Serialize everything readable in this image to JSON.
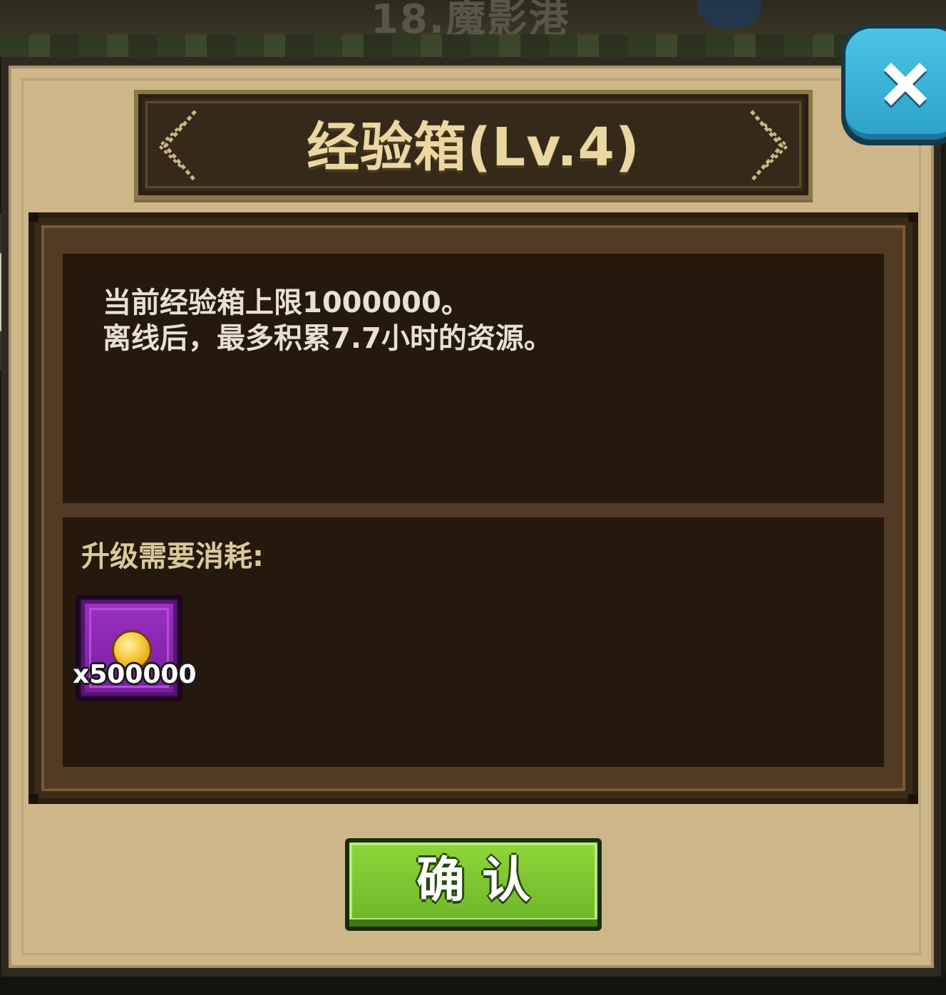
{
  "background": {
    "stage_title": "18.魔影港"
  },
  "dialog": {
    "title": "经验箱(Lv.4)",
    "description": [
      "当前经验箱上限1000000。",
      "离线后，最多积累7.7小时的资源。"
    ],
    "cost_label": "升级需要消耗:",
    "cost_items": [
      {
        "icon": "gold-coin-icon",
        "quantity": "x500000"
      }
    ],
    "confirm_label": "确认",
    "close_icon": "close-icon"
  },
  "colors": {
    "panel_bg": "#cdb789",
    "title_text": "#ead7a2",
    "content_bg": "#25180d",
    "confirm_green": "#7cc532",
    "close_blue": "#3bb3da",
    "item_rarity_purple": "#8a27b0"
  }
}
